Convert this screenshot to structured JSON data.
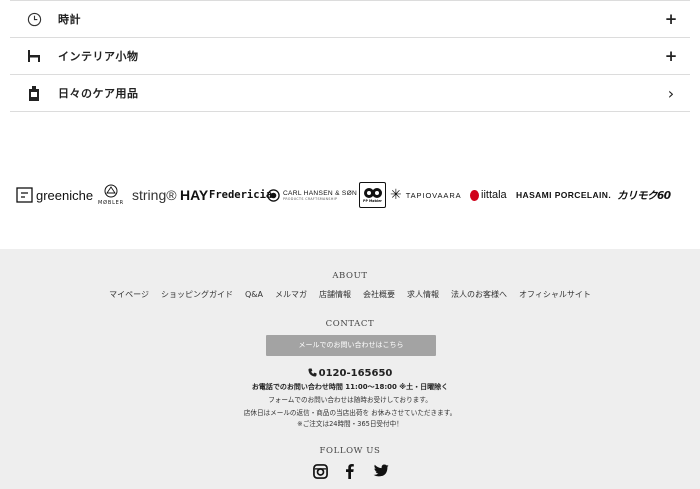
{
  "categories": [
    {
      "icon": "clock-icon",
      "label": "時計",
      "action": "+"
    },
    {
      "icon": "chair-icon",
      "label": "インテリア小物",
      "action": "+"
    },
    {
      "icon": "bottle-icon",
      "label": "日々のケア用品",
      "action": "›"
    }
  ],
  "brands": [
    {
      "name": "greeniche",
      "icon": "greeniche-logo"
    },
    {
      "name": "MØBLER",
      "icon": "mobler-logo"
    },
    {
      "name": "string®"
    },
    {
      "name": "HAY"
    },
    {
      "name": "Fredericia"
    },
    {
      "name": "CARL HANSEN & SØN",
      "sub": "PRODUCTS CRAFTSMANSHIP"
    },
    {
      "name": "PP Møbler",
      "icon": "pp-mobler-logo"
    },
    {
      "name": "TAPIOVAARA"
    },
    {
      "name": "iittala"
    },
    {
      "name": "HASAMI PORCELAIN."
    },
    {
      "name": "カリモク60"
    }
  ],
  "footer": {
    "about_title": "ABOUT",
    "nav_links": [
      "マイページ",
      "ショッピングガイド",
      "Q&A",
      "メルマガ",
      "店舗情報",
      "会社概要",
      "求人情報",
      "法人のお客様へ",
      "オフィシャルサイト"
    ],
    "contact_title": "CONTACT",
    "mail_button": "メールでのお問い合わせはこちら",
    "phone": "0120-165650",
    "phone_hours": "お電話でのお問い合わせ時間 11:00〜18:00 ※土・日曜除く",
    "form_note": "フォームでのお問い合わせは随時お受けしております。",
    "holiday_note": "店休日はメールの返信・商品の当店出荷を お休みさせていただきます。",
    "order_note": "※ご注文は24時間・365日受付中！",
    "follow_title": "FOLLOW US",
    "social": [
      "instagram-icon",
      "facebook-icon",
      "twitter-icon"
    ]
  }
}
